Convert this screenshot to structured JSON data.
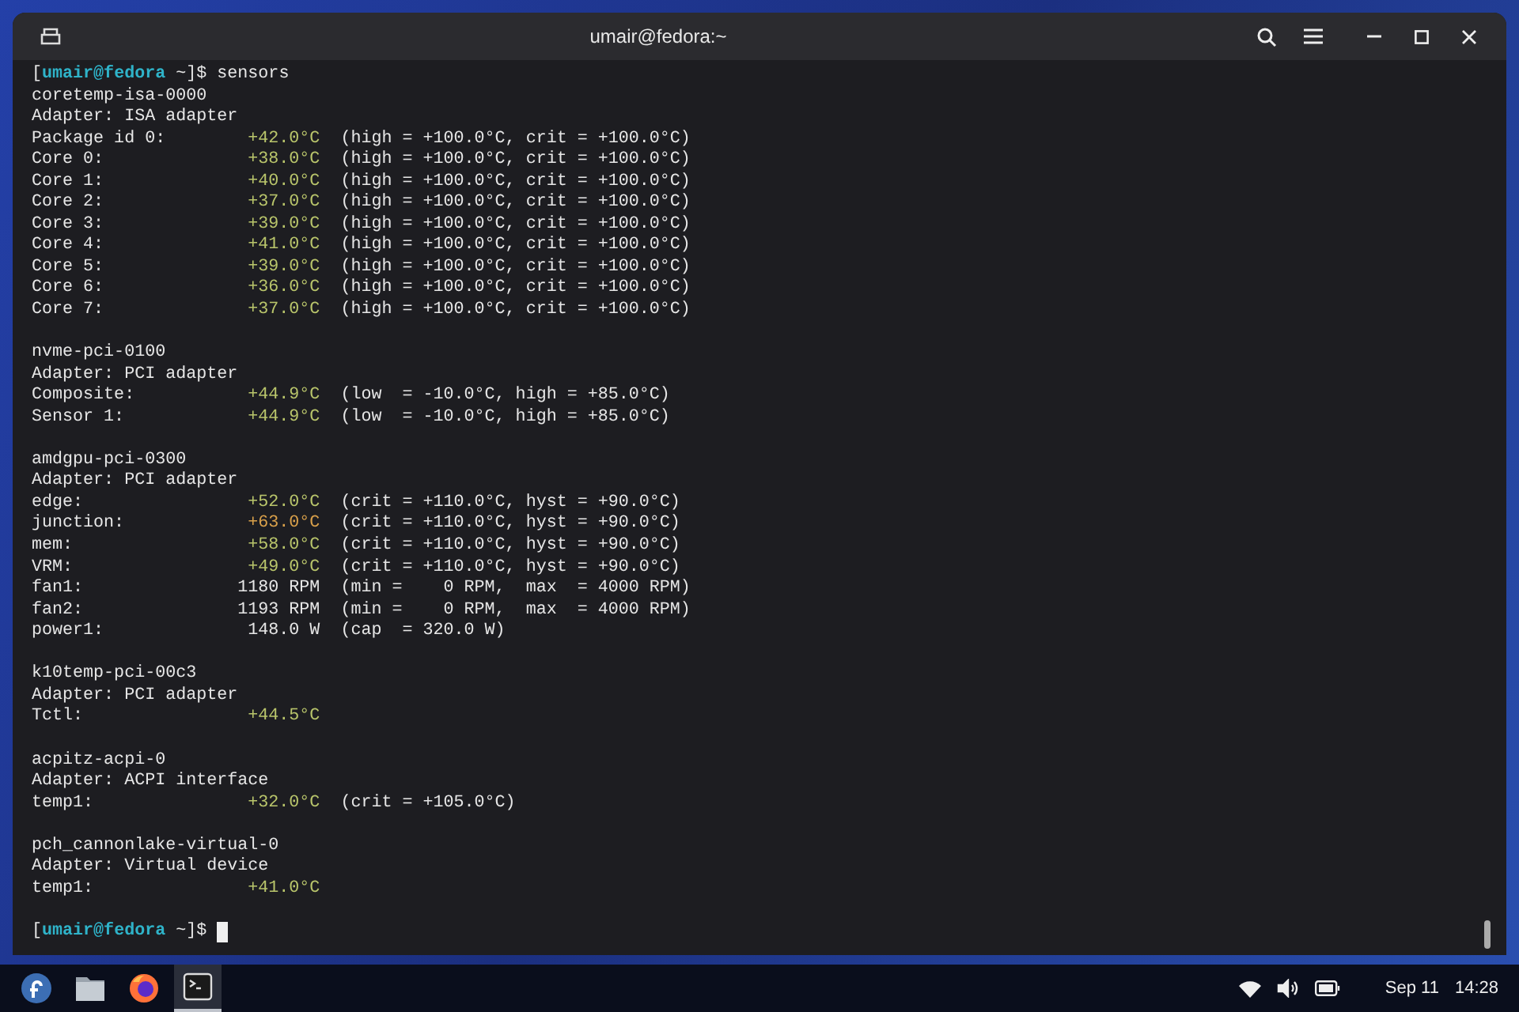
{
  "window": {
    "title": "umair@fedora:~"
  },
  "terminal": {
    "lines": [
      {
        "kind": "prompt",
        "prefix": "[",
        "user_host": "umair@fedora",
        "suffix": " ~]$ ",
        "command": "sensors",
        "cursor": false
      },
      {
        "kind": "text",
        "text": "coretemp-isa-0000"
      },
      {
        "kind": "text",
        "text": "Adapter: ISA adapter"
      },
      {
        "kind": "reading",
        "label": "Package id 0:",
        "value": "+42.0°C",
        "color": "#b9c56b",
        "limits": "(high = +100.0°C, crit = +100.0°C)"
      },
      {
        "kind": "reading",
        "label": "Core 0:",
        "value": "+38.0°C",
        "color": "#b9c56b",
        "limits": "(high = +100.0°C, crit = +100.0°C)"
      },
      {
        "kind": "reading",
        "label": "Core 1:",
        "value": "+40.0°C",
        "color": "#b9c56b",
        "limits": "(high = +100.0°C, crit = +100.0°C)"
      },
      {
        "kind": "reading",
        "label": "Core 2:",
        "value": "+37.0°C",
        "color": "#b9c56b",
        "limits": "(high = +100.0°C, crit = +100.0°C)"
      },
      {
        "kind": "reading",
        "label": "Core 3:",
        "value": "+39.0°C",
        "color": "#b9c56b",
        "limits": "(high = +100.0°C, crit = +100.0°C)"
      },
      {
        "kind": "reading",
        "label": "Core 4:",
        "value": "+41.0°C",
        "color": "#b9c56b",
        "limits": "(high = +100.0°C, crit = +100.0°C)"
      },
      {
        "kind": "reading",
        "label": "Core 5:",
        "value": "+39.0°C",
        "color": "#b9c56b",
        "limits": "(high = +100.0°C, crit = +100.0°C)"
      },
      {
        "kind": "reading",
        "label": "Core 6:",
        "value": "+36.0°C",
        "color": "#b9c56b",
        "limits": "(high = +100.0°C, crit = +100.0°C)"
      },
      {
        "kind": "reading",
        "label": "Core 7:",
        "value": "+37.0°C",
        "color": "#b9c56b",
        "limits": "(high = +100.0°C, crit = +100.0°C)"
      },
      {
        "kind": "blank"
      },
      {
        "kind": "text",
        "text": "nvme-pci-0100"
      },
      {
        "kind": "text",
        "text": "Adapter: PCI adapter"
      },
      {
        "kind": "reading",
        "label": "Composite:",
        "value": "+44.9°C",
        "color": "#b9c56b",
        "limits": "(low  = -10.0°C, high = +85.0°C)"
      },
      {
        "kind": "reading",
        "label": "Sensor 1:",
        "value": "+44.9°C",
        "color": "#b9c56b",
        "limits": "(low  = -10.0°C, high = +85.0°C)"
      },
      {
        "kind": "blank"
      },
      {
        "kind": "text",
        "text": "amdgpu-pci-0300"
      },
      {
        "kind": "text",
        "text": "Adapter: PCI adapter"
      },
      {
        "kind": "reading",
        "label": "edge:",
        "value": "+52.0°C",
        "color": "#b9c56b",
        "limits": "(crit = +110.0°C, hyst = +90.0°C)"
      },
      {
        "kind": "reading",
        "label": "junction:",
        "value": "+63.0°C",
        "color": "#d9a04a",
        "limits": "(crit = +110.0°C, hyst = +90.0°C)"
      },
      {
        "kind": "reading",
        "label": "mem:",
        "value": "+58.0°C",
        "color": "#b9c56b",
        "limits": "(crit = +110.0°C, hyst = +90.0°C)"
      },
      {
        "kind": "reading",
        "label": "VRM:",
        "value": "+49.0°C",
        "color": "#b9c56b",
        "limits": "(crit = +110.0°C, hyst = +90.0°C)"
      },
      {
        "kind": "reading",
        "label": "fan1:",
        "value": "1180 RPM",
        "limits": "(min =    0 RPM,  max  = 4000 RPM)"
      },
      {
        "kind": "reading",
        "label": "fan2:",
        "value": "1193 RPM",
        "limits": "(min =    0 RPM,  max  = 4000 RPM)"
      },
      {
        "kind": "reading",
        "label": "power1:",
        "value": "148.0 W",
        "limits": "(cap  = 320.0 W)"
      },
      {
        "kind": "blank"
      },
      {
        "kind": "text",
        "text": "k10temp-pci-00c3"
      },
      {
        "kind": "text",
        "text": "Adapter: PCI adapter"
      },
      {
        "kind": "reading",
        "label": "Tctl:",
        "value": "+44.5°C",
        "color": "#b9c56b"
      },
      {
        "kind": "blank"
      },
      {
        "kind": "text",
        "text": "acpitz-acpi-0"
      },
      {
        "kind": "text",
        "text": "Adapter: ACPI interface"
      },
      {
        "kind": "reading",
        "label": "temp1:",
        "value": "+32.0°C",
        "color": "#b9c56b",
        "limits": "(crit = +105.0°C)"
      },
      {
        "kind": "blank"
      },
      {
        "kind": "text",
        "text": "pch_cannonlake-virtual-0"
      },
      {
        "kind": "text",
        "text": "Adapter: Virtual device"
      },
      {
        "kind": "reading",
        "label": "temp1:",
        "value": "+41.0°C",
        "color": "#b9c56b"
      },
      {
        "kind": "blank"
      },
      {
        "kind": "prompt",
        "prefix": "[",
        "user_host": "umair@fedora",
        "suffix": " ~]$ ",
        "cursor": true
      }
    ]
  },
  "taskbar": {
    "apps": [
      {
        "kind": "fedora",
        "selected": false
      },
      {
        "kind": "files",
        "selected": false
      },
      {
        "kind": "firefox",
        "selected": false
      },
      {
        "kind": "terminal",
        "selected": true
      }
    ],
    "date": "Sep 11",
    "time": "14:28"
  }
}
